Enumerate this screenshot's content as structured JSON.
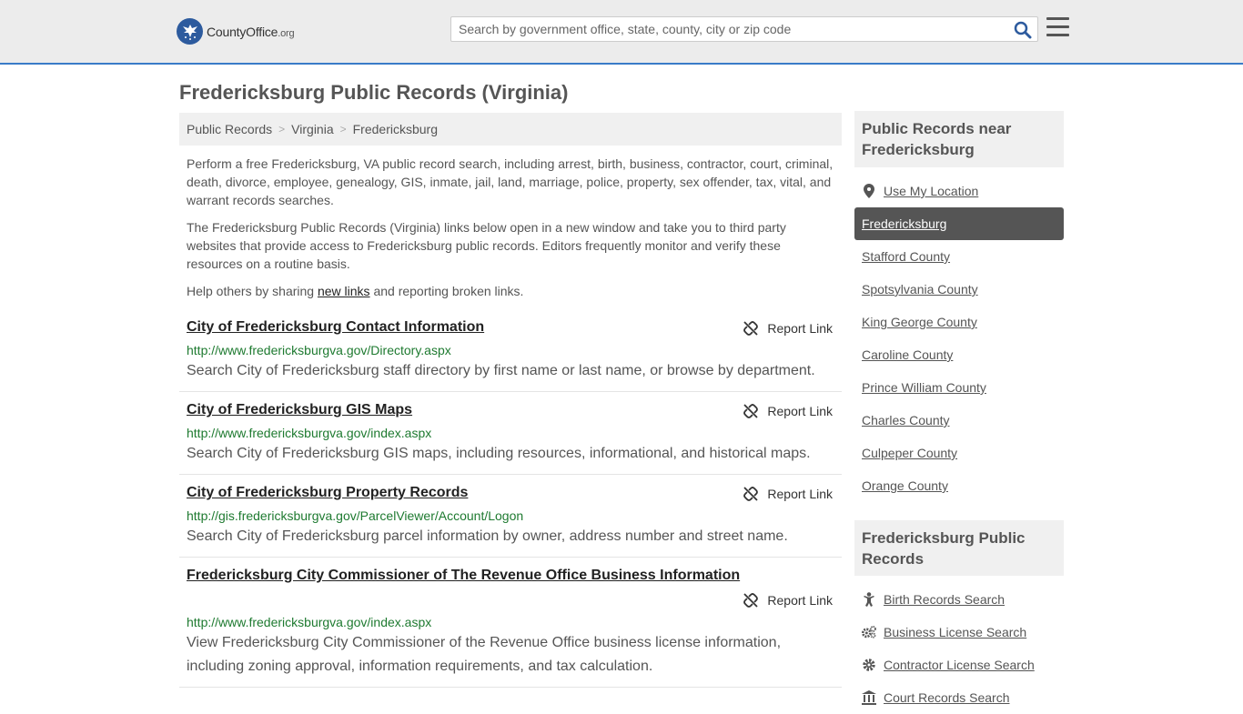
{
  "header": {
    "logo_main": "CountyOffice",
    "logo_suffix": ".org",
    "search_placeholder": "Search by government office, state, county, city or zip code"
  },
  "page": {
    "title": "Fredericksburg Public Records (Virginia)"
  },
  "breadcrumb": [
    "Public Records",
    "Virginia",
    "Fredericksburg"
  ],
  "intro": {
    "p1": "Perform a free Fredericksburg, VA public record search, including arrest, birth, business, contractor, court, criminal, death, divorce, employee, genealogy, GIS, inmate, jail, land, marriage, police, property, sex offender, tax, vital, and warrant records searches.",
    "p2": "The Fredericksburg Public Records (Virginia) links below open in a new window and take you to third party websites that provide access to Fredericksburg public records. Editors frequently monitor and verify these resources on a routine basis.",
    "p3_before": "Help others by sharing ",
    "p3_link": "new links",
    "p3_after": " and reporting broken links."
  },
  "report_label": "Report Link",
  "records": [
    {
      "title": "City of Fredericksburg Contact Information",
      "url": "http://www.fredericksburgva.gov/Directory.aspx",
      "desc": "Search City of Fredericksburg staff directory by first name or last name, or browse by department."
    },
    {
      "title": "City of Fredericksburg GIS Maps",
      "url": "http://www.fredericksburgva.gov/index.aspx",
      "desc": "Search City of Fredericksburg GIS maps, including resources, informational, and historical maps."
    },
    {
      "title": "City of Fredericksburg Property Records",
      "url": "http://gis.fredericksburgva.gov/ParcelViewer/Account/Logon",
      "desc": "Search City of Fredericksburg parcel information by owner, address number and street name."
    },
    {
      "title": "Fredericksburg City Commissioner of The Revenue Office Business Information",
      "url": "http://www.fredericksburgva.gov/index.aspx",
      "desc": "View Fredericksburg City Commissioner of the Revenue Office business license information, including zoning approval, information requirements, and tax calculation."
    }
  ],
  "sidebar": {
    "near_heading": "Public Records near Fredericksburg",
    "near_items": [
      "Use My Location",
      "Fredericksburg",
      "Stafford County",
      "Spotsylvania County",
      "King George County",
      "Caroline County",
      "Prince William County",
      "Charles County",
      "Culpeper County",
      "Orange County"
    ],
    "records_heading": "Fredericksburg Public Records",
    "records_items": [
      {
        "label": "Birth Records Search",
        "icon": "baby-icon"
      },
      {
        "label": "Business License Search",
        "icon": "gears-icon"
      },
      {
        "label": "Contractor License Search",
        "icon": "gear-icon"
      },
      {
        "label": "Court Records Search",
        "icon": "courthouse-icon"
      }
    ]
  },
  "colors": {
    "accent": "#3a7bc8",
    "url_green": "#1e7a30",
    "active_bg": "#555555"
  }
}
